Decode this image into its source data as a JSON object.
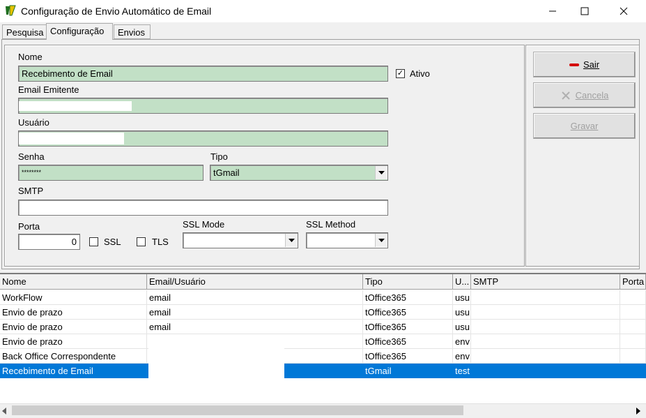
{
  "window": {
    "title": "Configuração de Envio Automático de Email",
    "minimize": "—",
    "maximize": "☐",
    "close": "✕"
  },
  "tabs": [
    {
      "label": "Pesquisa",
      "active": false
    },
    {
      "label": "Configuração",
      "active": true
    },
    {
      "label": "Envios",
      "active": false
    }
  ],
  "form": {
    "nome_label": "Nome",
    "nome_value": "Recebimento de Email",
    "ativo_label": "Ativo",
    "ativo_checked": "✓",
    "email_label": "Email Emitente",
    "email_value": "",
    "usuario_label": "Usuário",
    "usuario_value": "",
    "senha_label": "Senha",
    "senha_value": "********",
    "tipo_label": "Tipo",
    "tipo_value": "tGmail",
    "smtp_label": "SMTP",
    "smtp_value": "",
    "porta_label": "Porta",
    "porta_value": "0",
    "ssl_label": "SSL",
    "tls_label": "TLS",
    "sslmode_label": "SSL Mode",
    "sslmode_value": "",
    "sslmethod_label": "SSL Method",
    "sslmethod_value": ""
  },
  "buttons": {
    "sair_label": "Sair",
    "cancela_label": "Cancela",
    "gravar_label": "Gravar"
  },
  "grid": {
    "columns": [
      "Nome",
      "Email/Usuário",
      "Tipo",
      "U...",
      "SMTP",
      "Porta"
    ],
    "rows": [
      [
        "WorkFlow",
        "email",
        "tOffice365",
        "usu",
        "",
        ""
      ],
      [
        "Envio de prazo",
        "email",
        "tOffice365",
        "usu",
        "",
        ""
      ],
      [
        "Envio de prazo",
        "email",
        "tOffice365",
        "usu",
        "",
        ""
      ],
      [
        "Envio de prazo",
        "",
        "tOffice365",
        "env",
        "",
        ""
      ],
      [
        "Back Office Correspondente",
        "",
        "tOffice365",
        "env",
        "",
        ""
      ],
      [
        "Recebimento de Email",
        "",
        "tGmail",
        "test",
        "",
        ""
      ]
    ],
    "selected_row": 5
  },
  "colors": {
    "field_bg": "#c2e0c6",
    "selection": "#0078d7"
  }
}
